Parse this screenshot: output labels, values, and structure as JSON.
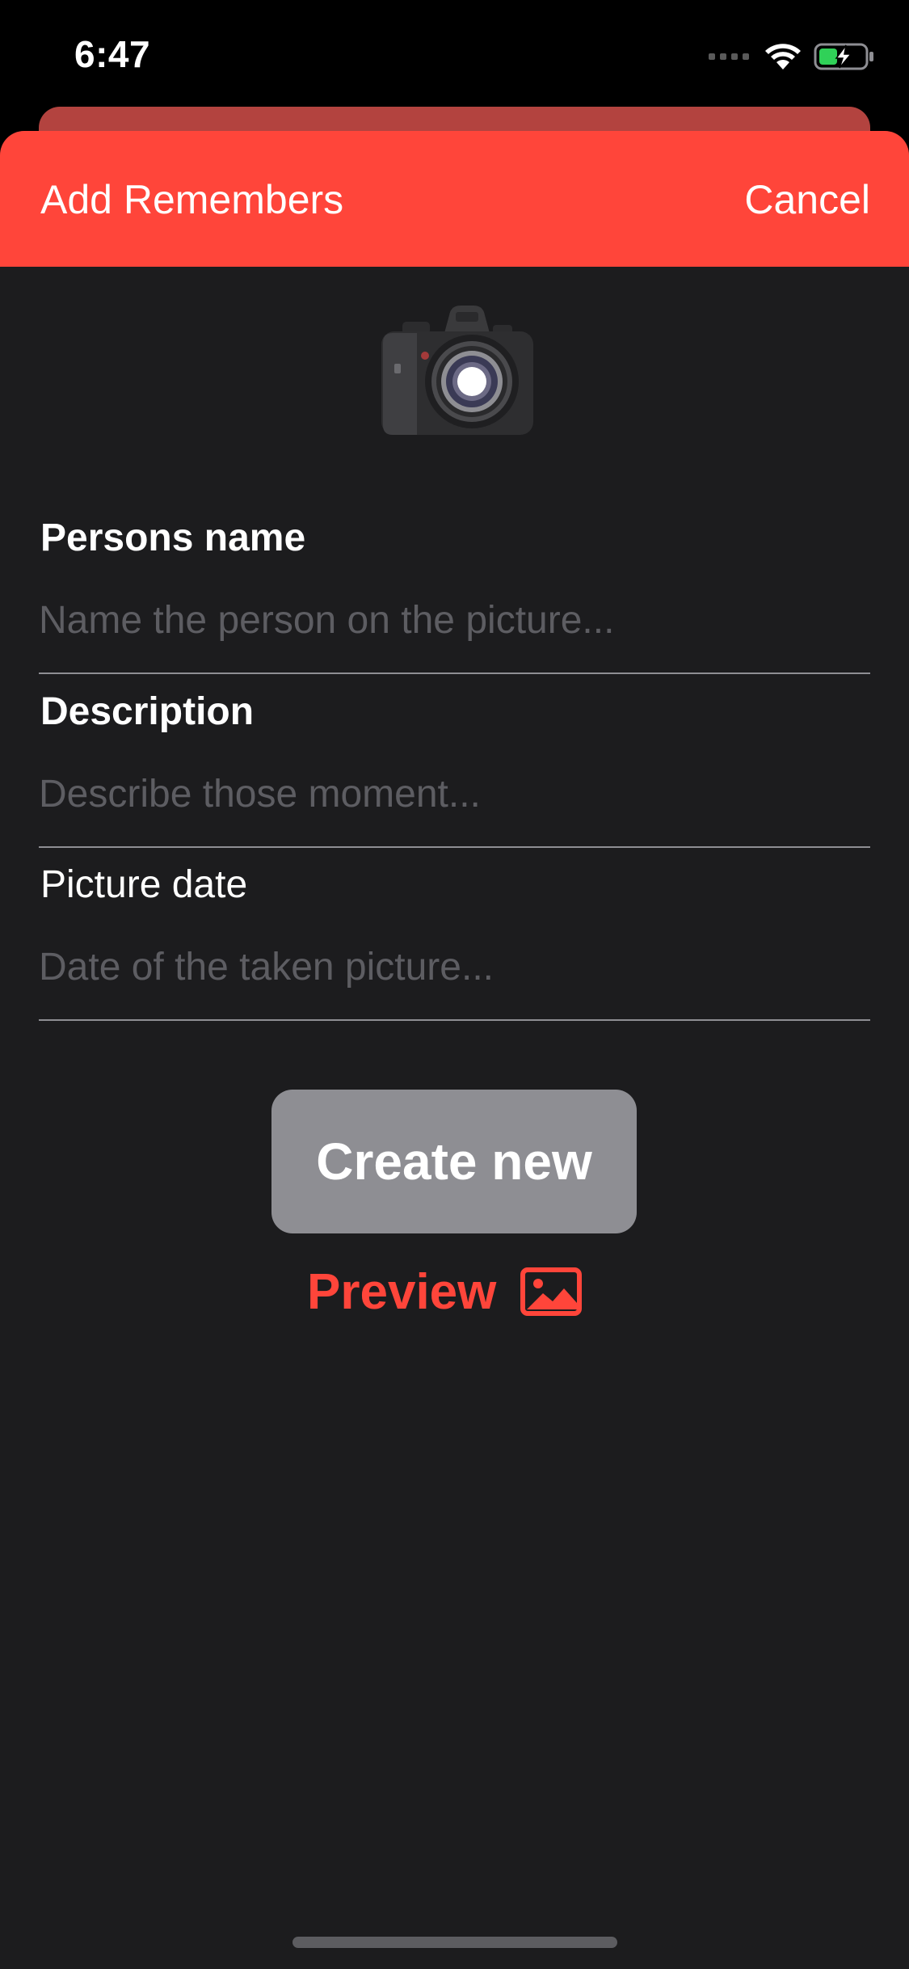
{
  "status_bar": {
    "time": "6:47",
    "icons": [
      "cellular-signal-icon",
      "wifi-icon",
      "battery-charging-icon"
    ]
  },
  "sheet": {
    "title": "Add Remembers",
    "cancel_label": "Cancel",
    "header_color": "#ff453a",
    "background_color": "#1c1c1e",
    "photo_icon": "camera-icon"
  },
  "form": {
    "fields": [
      {
        "label": "Persons name",
        "value": "",
        "placeholder": "Name the person on the picture..."
      },
      {
        "label": "Description",
        "value": "",
        "placeholder": "Describe those moment..."
      },
      {
        "label": "Picture date",
        "value": "",
        "placeholder": "Date of the taken picture..."
      }
    ],
    "create_label": "Create new",
    "preview_label": "Preview",
    "preview_icon": "photo-icon"
  }
}
